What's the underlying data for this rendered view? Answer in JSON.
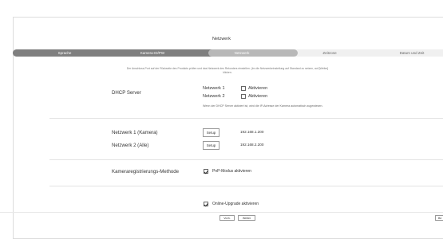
{
  "wizard": {
    "title": "Netzwerk",
    "steps": [
      "Sprache",
      "Kamera-ID/PW",
      "Netzwerk",
      "Zeitzone",
      "Datum und Zeit"
    ],
    "active_step": 3,
    "info_line1": "Der Anschluss-Port auf der Rückseite des Produkts prüfen und das Netzwerk des Rekorders einstellen. (Im die Netzwerkeinstellung auf Standard zu setzen, auf [Weiter]",
    "info_line2": "klicken."
  },
  "dhcp": {
    "label": "DHCP Server",
    "network1": "Netzwerk 1",
    "network2": "Netzwerk 2",
    "enable1": "Aktivieren",
    "enable2": "Aktivieren",
    "hint": "Wenn der DHCP Server aktiviert ist, wird die IP-Adresse der Kamera automatisch zugewiesen."
  },
  "networks": [
    {
      "label": "Netzwerk 1 (Kamera)",
      "button": "Setup",
      "ip": "192.168.1.200"
    },
    {
      "label": "Netzwerk 2 (Alle)",
      "button": "Setup",
      "ip": "192.168.2.200"
    }
  ],
  "registration": {
    "label": "Kameraregistrierungs-Methode",
    "pnp": "PnP-Modus aktivieren",
    "pnp_checked": true
  },
  "upgrade": {
    "label": "Online-Upgrade aktivieren",
    "checked": true
  },
  "footer": {
    "back": "Vorh.",
    "next": "Weiter",
    "right_cut": "Be"
  }
}
